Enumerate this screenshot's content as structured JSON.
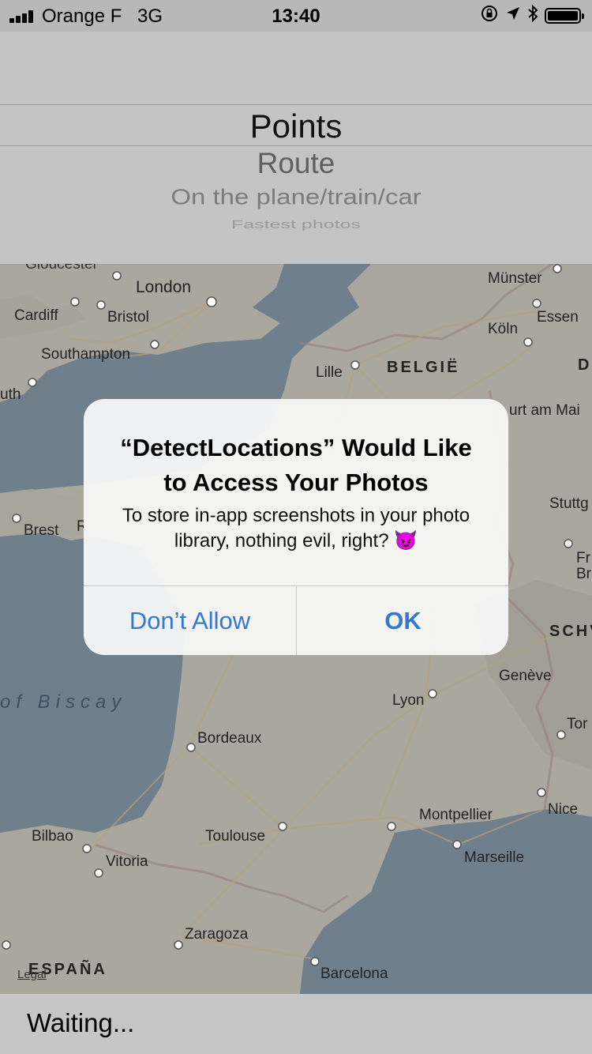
{
  "status_bar": {
    "carrier": "Orange F",
    "network": "3G",
    "time": "13:40",
    "icons": [
      "orientation-lock-icon",
      "location-arrow-icon",
      "bluetooth-icon",
      "battery-icon"
    ]
  },
  "picker": {
    "selected": "Points",
    "options": [
      "Route",
      "On the plane/train/car",
      "Fastest photos"
    ]
  },
  "map": {
    "labels": {
      "gloucester": "Gloucester",
      "london": "London",
      "cardiff": "Cardiff",
      "bristol": "Bristol",
      "southampton": "Southampton",
      "uth": "uth",
      "munster": "Münster",
      "essen": "Essen",
      "koln": "Köln",
      "lille": "Lille",
      "belgie": "BELGIË",
      "d": "D",
      "frankfurt": "urt am Mai",
      "brest": "Brest",
      "r": "R",
      "stuttgart": "Stuttg",
      "fr": "Fr",
      "br": "Br",
      "schweiz": "SCHV",
      "geneve": "Genève",
      "biscay": "of Biscay",
      "lyon": "Lyon",
      "torino": "Tor",
      "bordeaux": "Bordeaux",
      "nice": "Nice",
      "montpellier": "Montpellier",
      "bilbao": "Bilbao",
      "toulouse": "Toulouse",
      "marseille": "Marseille",
      "vitoria": "Vitoria",
      "zaragoza": "Zaragoza",
      "espana": "ESPAÑA",
      "legal": "Legal",
      "barcelona": "Barcelona"
    }
  },
  "alert": {
    "title": "“DetectLocations” Would Like to Access Your Photos",
    "message": "To store in-app screenshots in your photo library, nothing evil, right? 😈",
    "deny_label": "Don’t Allow",
    "ok_label": "OK"
  },
  "footer": {
    "status": "Waiting..."
  },
  "colors": {
    "accent": "#3478d4",
    "sea": "#6f7f8c",
    "land": "#a9a79e"
  }
}
